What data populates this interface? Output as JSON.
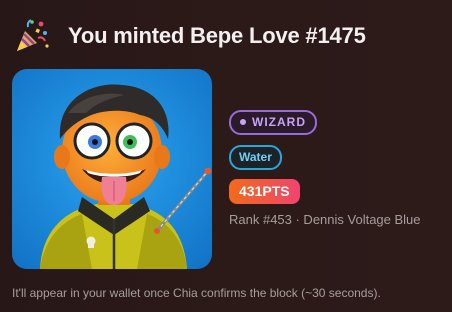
{
  "header": {
    "icon": "party-popper-icon",
    "title": "You minted Bepe Love #1475"
  },
  "nft": {
    "image_description_icon": "nft-character-image",
    "class_label": "WIZARD",
    "element_label": "Water",
    "points_label": "431PTS",
    "rank_text": "Rank #453 · Dennis Voltage Blue"
  },
  "footer": {
    "message": "It'll appear in your wallet once Chia confirms the block (~30 seconds)."
  },
  "colors": {
    "background": "#2a1918",
    "class_pill_border": "#9a6bd6",
    "element_pill_border": "#2ba6d8",
    "points_gradient_start": "#f26a1b",
    "points_gradient_end": "#f0446f",
    "image_background": "#1e90e0"
  }
}
